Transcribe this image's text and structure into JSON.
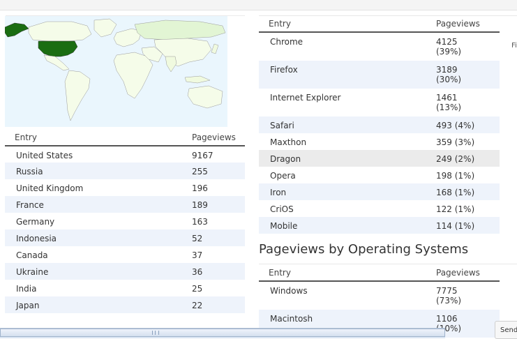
{
  "countries": {
    "headers": {
      "entry": "Entry",
      "pageviews": "Pageviews"
    },
    "rows": [
      {
        "entry": "United States",
        "pageviews": "9167"
      },
      {
        "entry": "Russia",
        "pageviews": "255"
      },
      {
        "entry": "United Kingdom",
        "pageviews": "196"
      },
      {
        "entry": "France",
        "pageviews": "189"
      },
      {
        "entry": "Germany",
        "pageviews": "163"
      },
      {
        "entry": "Indonesia",
        "pageviews": "52"
      },
      {
        "entry": "Canada",
        "pageviews": "37"
      },
      {
        "entry": "Ukraine",
        "pageviews": "36"
      },
      {
        "entry": "India",
        "pageviews": "25"
      },
      {
        "entry": "Japan",
        "pageviews": "22"
      }
    ]
  },
  "browsers": {
    "headers": {
      "entry": "Entry",
      "pageviews": "Pageviews"
    },
    "rows": [
      {
        "entry": "Chrome",
        "pageviews": "4125",
        "percent": "(39%)"
      },
      {
        "entry": "Firefox",
        "pageviews": "3189",
        "percent": "(30%)"
      },
      {
        "entry": "Internet Explorer",
        "pageviews": "1461",
        "percent": "(13%)"
      },
      {
        "entry": "Safari",
        "pageviews": "493 (4%)"
      },
      {
        "entry": "Maxthon",
        "pageviews": "359 (3%)"
      },
      {
        "entry": "Dragon",
        "pageviews": "249 (2%)"
      },
      {
        "entry": "Opera",
        "pageviews": "198 (1%)"
      },
      {
        "entry": "Iron",
        "pageviews": "168 (1%)"
      },
      {
        "entry": "CriOS",
        "pageviews": "122 (1%)"
      },
      {
        "entry": "Mobile",
        "pageviews": "114 (1%)"
      }
    ]
  },
  "os_section": {
    "title": "Pageviews by Operating Systems",
    "headers": {
      "entry": "Entry",
      "pageviews": "Pageviews"
    },
    "rows": [
      {
        "entry": "Windows",
        "pageviews": "7775",
        "percent": "(73%)"
      },
      {
        "entry": "Macintosh",
        "pageviews": "1106",
        "percent": "(10%)"
      }
    ]
  },
  "edge_text": "Fi",
  "send_button": "Send",
  "colors": {
    "map_water": "#eaf6fd",
    "map_land": "#f5fce9",
    "map_highlight": "#1a6d12",
    "row_alt": "#eef3fb",
    "row_hover": "#ebebeb"
  }
}
